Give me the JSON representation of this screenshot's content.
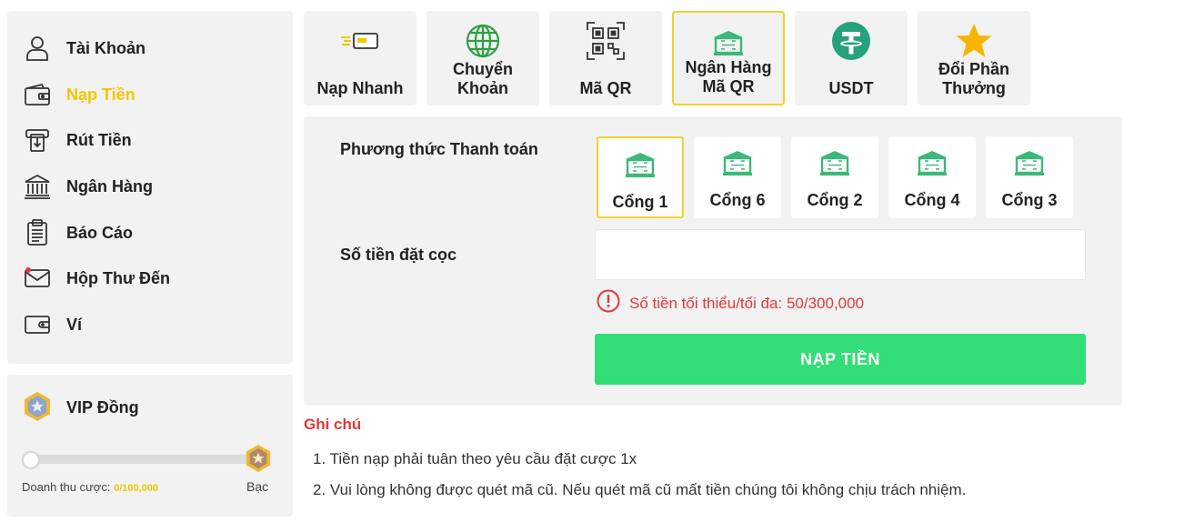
{
  "sidebar": {
    "items": [
      {
        "label": "Tài Khoản",
        "icon": "user-icon"
      },
      {
        "label": "Nạp Tiền",
        "icon": "wallet-deposit-icon",
        "active": true
      },
      {
        "label": "Rút Tiền",
        "icon": "withdraw-icon"
      },
      {
        "label": "Ngân Hàng",
        "icon": "bank-icon"
      },
      {
        "label": "Báo Cáo",
        "icon": "report-icon"
      },
      {
        "label": "Hộp Thư Đến",
        "icon": "mail-icon"
      },
      {
        "label": "Ví",
        "icon": "wallet-icon"
      }
    ]
  },
  "vip": {
    "title": "VIP Đồng",
    "revenue_label": "Doanh thu cược:",
    "revenue_value": "0/100,000",
    "progress": 0,
    "next_level": "Bạc"
  },
  "tabs": [
    {
      "label": "Nạp Nhanh",
      "icon": "card-fast-icon"
    },
    {
      "label": "Chuyển Khoản",
      "icon": "globe-icon"
    },
    {
      "label": "Mã QR",
      "icon": "qr-code-icon"
    },
    {
      "label": "Ngân Hàng Mã QR",
      "icon": "bank-qr-icon",
      "active": true
    },
    {
      "label": "USDT",
      "icon": "tether-icon"
    },
    {
      "label": "Đổi Phần Thưởng",
      "icon": "star-icon"
    }
  ],
  "form": {
    "payment_method_label": "Phương thức Thanh toán",
    "gates": [
      {
        "label": "Cổng 1",
        "active": true
      },
      {
        "label": "Cổng 6"
      },
      {
        "label": "Cổng 2"
      },
      {
        "label": "Cổng 4"
      },
      {
        "label": "Cổng 3"
      }
    ],
    "amount_label": "Số tiền đặt cọc",
    "amount_value": "",
    "amount_placeholder": "",
    "limit_text": "Số tiền tối thiểu/tối đa: 50/300,000",
    "submit_label": "NẠP TIỀN"
  },
  "notes": {
    "title": "Ghi chú",
    "items": [
      "1. Tiền nạp phải tuân theo yêu cầu đặt cược 1x",
      "2. Vui lòng không được quét mã cũ. Nếu quét mã cũ mất tiền chúng tôi không chịu trách nhiệm."
    ]
  },
  "colors": {
    "accent": "#f7c600",
    "success": "#33dd77",
    "error": "#e03a3a",
    "bank_green": "#3cb878"
  }
}
